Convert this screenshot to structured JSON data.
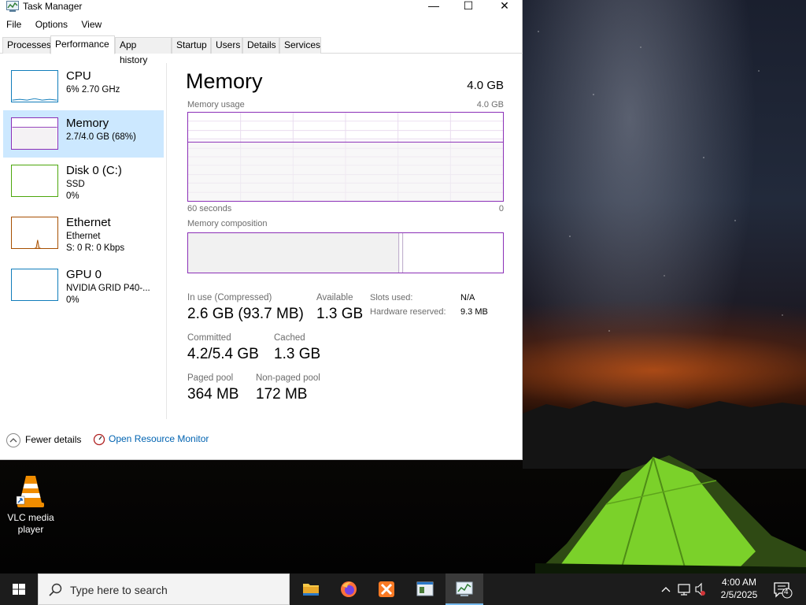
{
  "window": {
    "title": "Task Manager",
    "controls": {
      "minimize": "—",
      "maximize": "☐",
      "close": "✕"
    }
  },
  "menu": [
    "File",
    "Options",
    "View"
  ],
  "tabs": [
    "Processes",
    "Performance",
    "App history",
    "Startup",
    "Users",
    "Details",
    "Services"
  ],
  "active_tab": "Performance",
  "sidebar": [
    {
      "name": "CPU",
      "line1": "6%  2.70 GHz",
      "line2": "",
      "color": "#117dbb"
    },
    {
      "name": "Memory",
      "line1": "2.7/4.0 GB (68%)",
      "line2": "",
      "color": "#8b2fb7"
    },
    {
      "name": "Disk 0 (C:)",
      "line1": "SSD",
      "line2": "0%",
      "color": "#4da60c"
    },
    {
      "name": "Ethernet",
      "line1": "Ethernet",
      "line2": "S: 0  R: 0 Kbps",
      "color": "#a74f01"
    },
    {
      "name": "GPU 0",
      "line1": "NVIDIA GRID P40-...",
      "line2": "0%",
      "color": "#117dbb"
    }
  ],
  "memory": {
    "heading": "Memory",
    "total": "4.0 GB",
    "usage_label": "Memory usage",
    "usage_max": "4.0 GB",
    "time_left": "60 seconds",
    "time_right": "0",
    "composition_label": "Memory composition",
    "in_use_fraction": 0.67,
    "stats": {
      "in_use_label": "In use (Compressed)",
      "in_use_value": "2.6 GB (93.7 MB)",
      "available_label": "Available",
      "available_value": "1.3 GB",
      "committed_label": "Committed",
      "committed_value": "4.2/5.4 GB",
      "cached_label": "Cached",
      "cached_value": "1.3 GB",
      "paged_label": "Paged pool",
      "paged_value": "364 MB",
      "nonpaged_label": "Non-paged pool",
      "nonpaged_value": "172 MB",
      "slots_label": "Slots used:",
      "slots_value": "N/A",
      "hw_label": "Hardware reserved:",
      "hw_value": "9.3 MB"
    }
  },
  "footer": {
    "fewer": "Fewer details",
    "resource_monitor": "Open Resource Monitor"
  },
  "desktop_icon": {
    "label": "VLC media player"
  },
  "taskbar": {
    "search_placeholder": "Type here to search",
    "time": "4:00 AM",
    "date": "2/5/2025",
    "notifications": "4"
  }
}
